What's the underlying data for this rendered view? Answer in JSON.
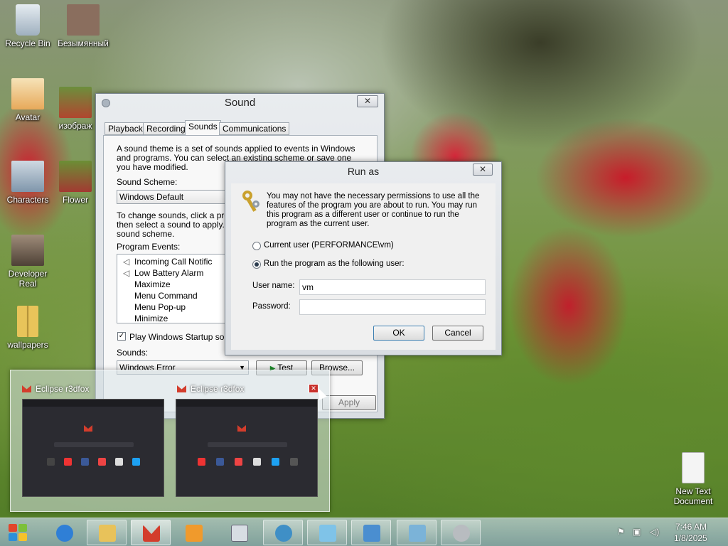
{
  "desktop": {
    "icons": [
      {
        "label": "Recycle Bin",
        "color": "#c9d3dc"
      },
      {
        "label": "Безымянный",
        "color": "#8a6e5e"
      },
      {
        "label": "Avatar",
        "color": "#f1c37a"
      },
      {
        "label": "изображ",
        "color": "#b0462f"
      },
      {
        "label": "Characters",
        "color": "#9fb3c5"
      },
      {
        "label": "Flower",
        "color": "#a23a32"
      },
      {
        "label": "Developer Real",
        "color": "#6e5d4e"
      },
      {
        "label": "wallpapers",
        "color": "#e2c35c"
      },
      {
        "label": "New Text Document",
        "color": "#f4f4f4"
      }
    ]
  },
  "sound_dialog": {
    "title": "Sound",
    "close_glyph": "✕",
    "tabs": [
      "Playback",
      "Recording",
      "Sounds",
      "Communications"
    ],
    "selected_tab": "Sounds",
    "description": "A sound theme is a set of sounds applied to events in Windows and programs.  You can select an existing scheme or save one you have modified.",
    "scheme_label": "Sound Scheme:",
    "scheme_value": "Windows Default",
    "change_text_line1": "To change sounds, click a pro",
    "change_text_line2": "then select a sound to apply.",
    "change_text_line3": "sound scheme.",
    "events_label": "Program Events:",
    "events": [
      "Incoming Call Notific",
      "Low Battery Alarm",
      "Maximize",
      "Menu Command",
      "Menu Pop-up",
      "Minimize"
    ],
    "startup_checkbox": "Play Windows Startup sou",
    "sounds_label": "Sounds:",
    "sound_value": "Windows Error",
    "test_button": "Test",
    "browse_button": "Browse...",
    "apply_button": "Apply"
  },
  "runas_dialog": {
    "title": "Run as",
    "close_glyph": "✕",
    "message": "You may not have the necessary permissions to use all the features of the program you are about to run. You may run this program as a different user or continue to run the program as the current user.",
    "option_current": "Current user (PERFORMANCE\\vm)",
    "option_other": "Run the program as the following user:",
    "selected_option": "other",
    "username_label": "User name:",
    "username_value": "vm",
    "password_label": "Password:",
    "password_value": "",
    "ok_button": "OK",
    "cancel_button": "Cancel"
  },
  "thumbnails": [
    {
      "title": "Eclipse r3dfox"
    },
    {
      "title": "Eclipse r3dfox"
    }
  ],
  "thumb_close_glyph": "✕",
  "taskbar": {
    "buttons": [
      {
        "name": "ie",
        "color": "#2f7fd6"
      },
      {
        "name": "explorer",
        "color": "#e8c25a"
      },
      {
        "name": "r3dfox",
        "color": "#d33d2c"
      },
      {
        "name": "media-player",
        "color": "#f09a2c"
      },
      {
        "name": "notepad",
        "color": "#d7dde3"
      },
      {
        "name": "network",
        "color": "#3f8fc6"
      },
      {
        "name": "app-blue",
        "color": "#7fc3e8"
      },
      {
        "name": "control-panel",
        "color": "#4a8ed0"
      },
      {
        "name": "media-center",
        "color": "#7bb3d8"
      },
      {
        "name": "sound",
        "color": "#b8bcc0"
      }
    ],
    "time": "7:46 AM",
    "date": "1/8/2025"
  }
}
